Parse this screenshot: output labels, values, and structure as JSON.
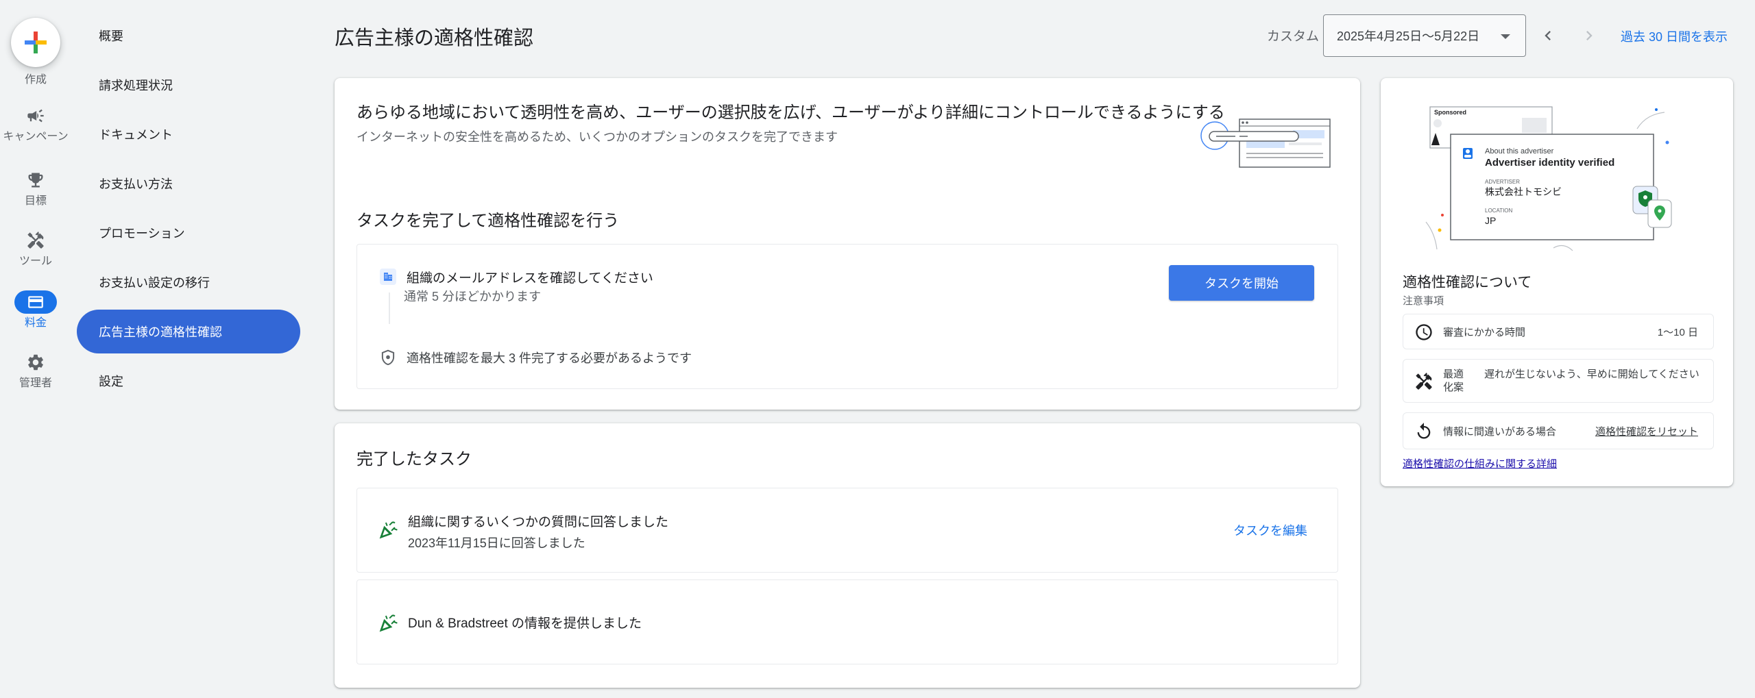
{
  "rail": {
    "create_label": "作成",
    "items": [
      {
        "label": "キャンペーン",
        "icon": "megaphone-icon"
      },
      {
        "label": "目標",
        "icon": "trophy-icon"
      },
      {
        "label": "ツール",
        "icon": "tools-icon"
      },
      {
        "label": "料金",
        "icon": "credit-card-icon",
        "active": true
      },
      {
        "label": "管理者",
        "icon": "gear-icon"
      }
    ]
  },
  "subnav": {
    "items": [
      {
        "label": "概要"
      },
      {
        "label": "請求処理状況"
      },
      {
        "label": "ドキュメント"
      },
      {
        "label": "お支払い方法"
      },
      {
        "label": "プロモーション"
      },
      {
        "label": "お支払い設定の移行"
      },
      {
        "label": "広告主様の適格性確認",
        "active": true
      },
      {
        "label": "設定"
      }
    ]
  },
  "header": {
    "title": "広告主様の適格性確認",
    "custom_label": "カスタム",
    "date_range": "2025年4月25日〜5月22日",
    "show_last_30": "過去 30 日間を表示"
  },
  "main": {
    "hero_title": "あらゆる地域において透明性を高め、ユーザーの選択肢を広げ、ユーザーがより詳細にコントロールできるようにする",
    "hero_subtitle": "インターネットの安全性を高めるため、いくつかのオプションのタスクを完了できます",
    "section_title": "タスクを完了して適格性確認を行う",
    "task": {
      "title": "組織のメールアドレスを確認してください",
      "duration": "通常 5 分ほどかかります",
      "start_button": "タスクを開始"
    },
    "limit_note": "適格性確認を最大 3 件完了する必要があるようです"
  },
  "completed": {
    "title": "完了したタスク",
    "items": [
      {
        "title": "組織に関するいくつかの質問に回答しました",
        "date": "2023年11月15日に回答しました",
        "action": "タスクを編集"
      },
      {
        "title": "Dun & Bradstreet の情報を提供しました"
      }
    ]
  },
  "side": {
    "illustration": {
      "sponsored": "Sponsored",
      "about": "About this advertiser",
      "verified": "Advertiser identity verified",
      "advertiser_label": "ADVERTISER",
      "advertiser_name": "株式会社トモシビ",
      "location_label": "LOCATION",
      "location_value": "JP"
    },
    "title": "適格性確認について",
    "subtitle": "注意事項",
    "rows": [
      {
        "label": "審査にかかる時間",
        "value": "1〜10 日",
        "icon": "clock-icon"
      },
      {
        "label": "最適化案",
        "value": "遅れが生じないよう、早めに開始してください",
        "icon": "tools-icon"
      },
      {
        "label": "情報に間違いがある場合",
        "value": "適格性確認をリセット",
        "icon": "reset-icon"
      }
    ],
    "detail_link": "適格性確認の仕組みに関する詳細"
  },
  "colors": {
    "accent": "#1a73e8",
    "active_nav": "#3367d6",
    "button": "#3b78e7",
    "success_icon": "#188038"
  }
}
